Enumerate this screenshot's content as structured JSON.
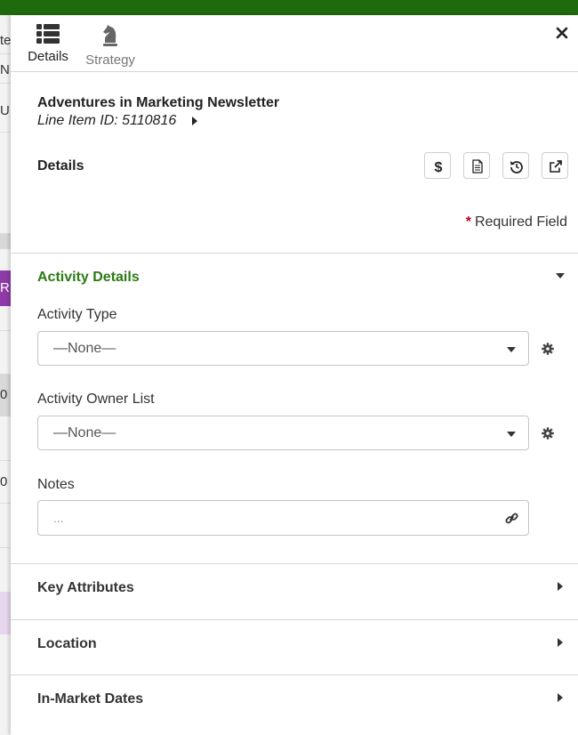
{
  "background": {
    "fragments": [
      "te",
      "N",
      "U",
      "R",
      "0",
      "0"
    ]
  },
  "tabs": [
    {
      "label": "Details",
      "icon": "list-icon"
    },
    {
      "label": "Strategy",
      "icon": "chess-knight-icon"
    }
  ],
  "header": {
    "title": "Adventures in Marketing Newsletter",
    "line_item": "Line Item ID: 5110816"
  },
  "details": {
    "label": "Details",
    "actions": [
      "dollar-icon",
      "document-icon",
      "history-icon",
      "external-link-icon"
    ]
  },
  "required": {
    "star": "*",
    "text": "Required Field"
  },
  "activity_details": {
    "title": "Activity Details",
    "activity_type_label": "Activity Type",
    "activity_type_value": "—None—",
    "owner_list_label": "Activity Owner List",
    "owner_list_value": "—None—",
    "notes_label": "Notes",
    "notes_placeholder": "..."
  },
  "sections": [
    {
      "title": "Key Attributes"
    },
    {
      "title": "Location"
    },
    {
      "title": "In-Market Dates"
    }
  ],
  "colors": {
    "topbar": "#1e6b0e",
    "accent_green": "#2c7a14",
    "required_red": "#c0001c",
    "purple": "#8e3aa8"
  }
}
